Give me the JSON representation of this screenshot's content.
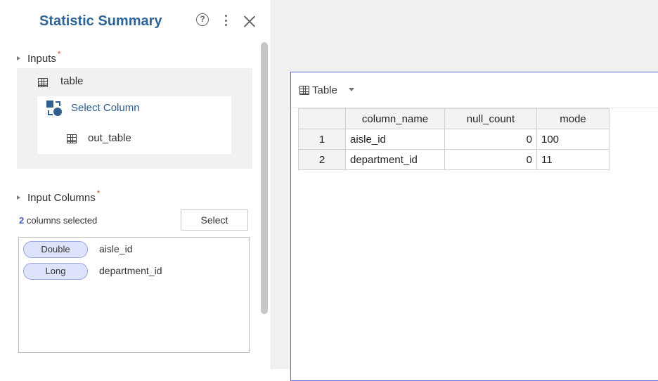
{
  "panel": {
    "title": "Statistic Summary",
    "help_glyph": "?",
    "inputs_label": "Inputs",
    "required_mark": "*",
    "input_table": "table",
    "operation": "Select Column",
    "output_table": "out_table",
    "input_columns_label": "Input Columns",
    "columns_selected_count": "2",
    "columns_selected_text": " columns selected",
    "select_button": "Select",
    "columns": [
      {
        "type": "Double",
        "name": "aisle_id"
      },
      {
        "type": "Long",
        "name": "department_id"
      }
    ]
  },
  "preview": {
    "view_label": "Table",
    "headers": [
      "",
      "column_name",
      "null_count",
      "mode"
    ],
    "rows": [
      [
        "1",
        "aisle_id",
        "0",
        "100"
      ],
      [
        "2",
        "department_id",
        "0",
        "11"
      ]
    ]
  },
  "colors": {
    "title": "#2f6497",
    "accent_border": "#5a6de0",
    "pill_fill": "#dde3fb",
    "required": "#e0503c"
  }
}
